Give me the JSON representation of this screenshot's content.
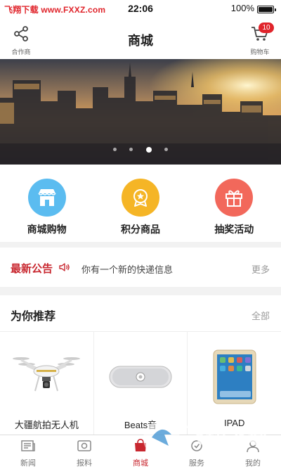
{
  "status_bar": {
    "left_text": "飞翔下载 www.FXXZ.com",
    "time": "22:06",
    "battery": "100%"
  },
  "nav": {
    "title": "商城",
    "left_label": "合作商",
    "right_label": "购物车",
    "cart_count": "10"
  },
  "banner": {
    "slide_count": 4,
    "active_slide": 3
  },
  "quick_nav": [
    {
      "label": "商城购物",
      "icon": "store-icon",
      "color": "#5bbcf0"
    },
    {
      "label": "积分商品",
      "icon": "medal-icon",
      "color": "#f5b526"
    },
    {
      "label": "抽奖活动",
      "icon": "gift-icon",
      "color": "#f2685b"
    }
  ],
  "notice": {
    "title": "最新公告",
    "text": "你有一个新的快递信息",
    "more": "更多"
  },
  "recommend": {
    "title": "为你推荐",
    "all": "全部",
    "products": [
      {
        "name": "大疆航拍无人机",
        "icon": "drone-icon"
      },
      {
        "name": "Beats音",
        "icon": "speaker-icon"
      },
      {
        "name": "IPAD",
        "icon": "tablet-icon"
      }
    ]
  },
  "tabs": [
    {
      "label": "新闻",
      "icon": "news-icon",
      "active": false
    },
    {
      "label": "报料",
      "icon": "report-icon",
      "active": false
    },
    {
      "label": "商城",
      "icon": "mall-icon",
      "active": true
    },
    {
      "label": "服务",
      "icon": "service-icon",
      "active": false
    },
    {
      "label": "我的",
      "icon": "profile-icon",
      "active": false
    }
  ],
  "watermark": {
    "brand": "飞翔下载",
    "url": "www.fxxz.com"
  },
  "colors": {
    "accent": "#c8272f",
    "badge": "#e0242b"
  }
}
